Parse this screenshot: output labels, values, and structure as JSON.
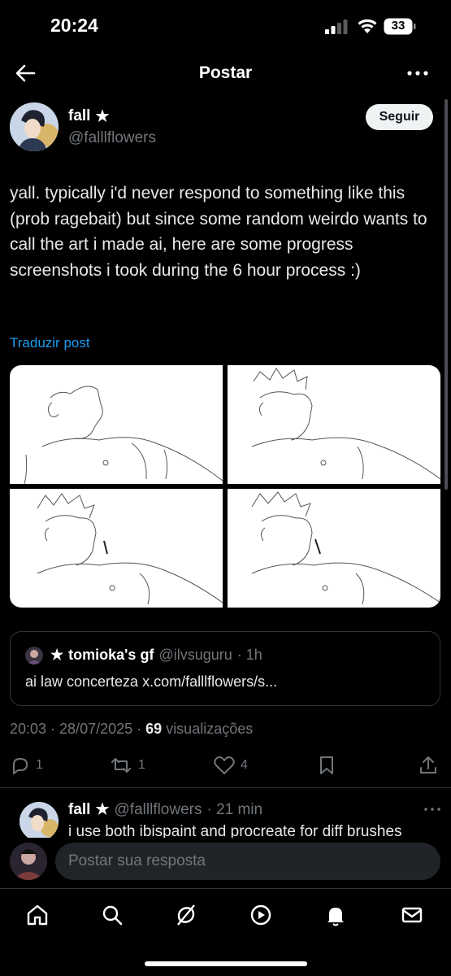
{
  "status": {
    "time": "20:24",
    "battery": "33"
  },
  "header": {
    "title": "Postar"
  },
  "post": {
    "author_name": "fall",
    "author_star": "★",
    "author_handle": "@falllflowers",
    "follow_label": "Seguir",
    "text": "yall. typically i'd never respond to something like this (prob ragebait) but since some random weirdo wants to call the art i made ai, here are some progress screenshots i took during the 6 hour process :)",
    "translate_label": "Traduzir post",
    "quote": {
      "star": "★",
      "author_name": "tomioka's gf",
      "author_handle": "@ilvsuguru",
      "time": "· 1h",
      "text": "ai law concerteza x.com/falllflowers/s..."
    },
    "timestamp": "20:03 · 28/07/2025 ·",
    "views": "69",
    "views_label": "visualizações",
    "actions": {
      "replies": "1",
      "reposts": "1",
      "likes": "4"
    }
  },
  "reply": {
    "author_name": "fall",
    "author_star": "★",
    "author_handle": "@falllflowers",
    "time": "· 21 min",
    "text": "i use both ibispaint and procreate for diff brushes"
  },
  "composer": {
    "placeholder": "Postar sua resposta"
  },
  "colors": {
    "accent": "#1d9bf0",
    "muted": "#71767b",
    "background": "#000000"
  },
  "icons": [
    "back-arrow-icon",
    "more-icon",
    "reply-icon",
    "repost-icon",
    "like-icon",
    "bookmark-icon",
    "share-icon",
    "home-icon",
    "search-icon",
    "grok-icon",
    "media-icon",
    "notifications-icon",
    "messages-icon"
  ]
}
